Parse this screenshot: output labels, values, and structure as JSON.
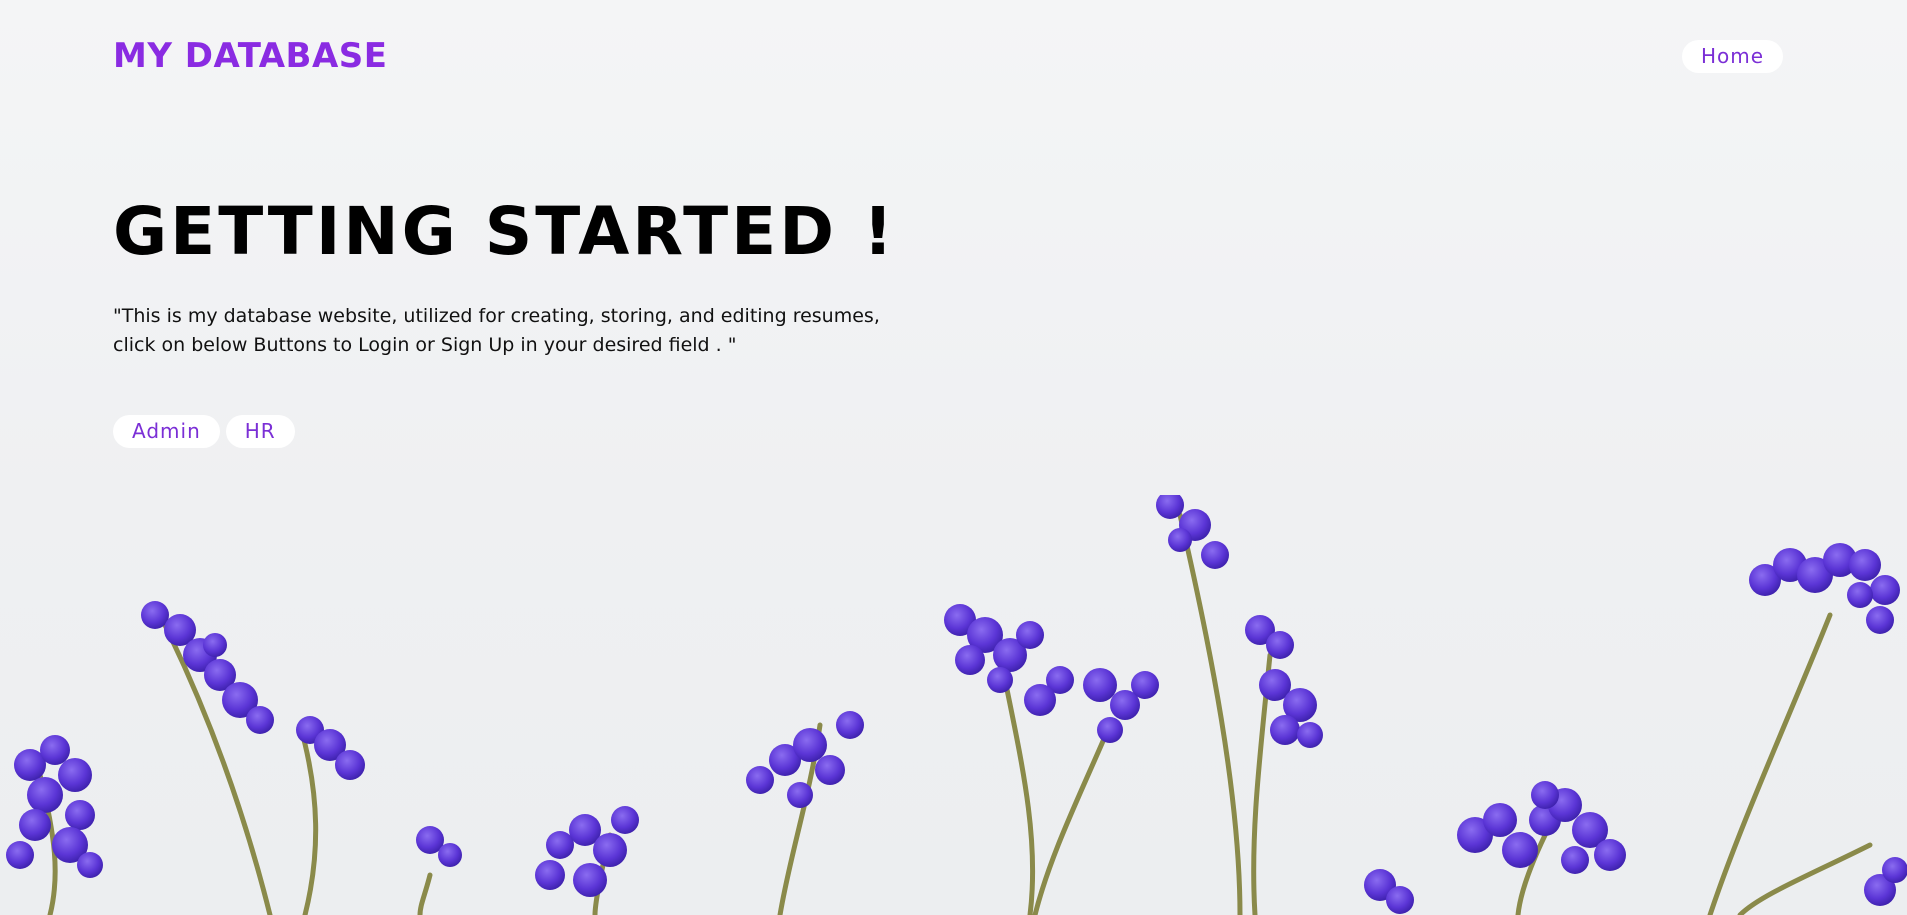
{
  "header": {
    "logo": "MY DATABASE",
    "nav_home": "Home"
  },
  "hero": {
    "title": "GETTING STARTED !",
    "description": "\"This is my database website, utilized for creating, storing, and editing resumes, click on below Buttons to Login or Sign Up in your desired field . \""
  },
  "actions": {
    "admin_label": "Admin",
    "hr_label": "HR"
  },
  "colors": {
    "accent": "#8a2be2",
    "button_text": "#7b2fd6",
    "background": "#f2f3f4",
    "flower": "#5b35d6",
    "stem": "#8a8a4a"
  },
  "decoration": {
    "image": "purple-flowers-illustration"
  }
}
